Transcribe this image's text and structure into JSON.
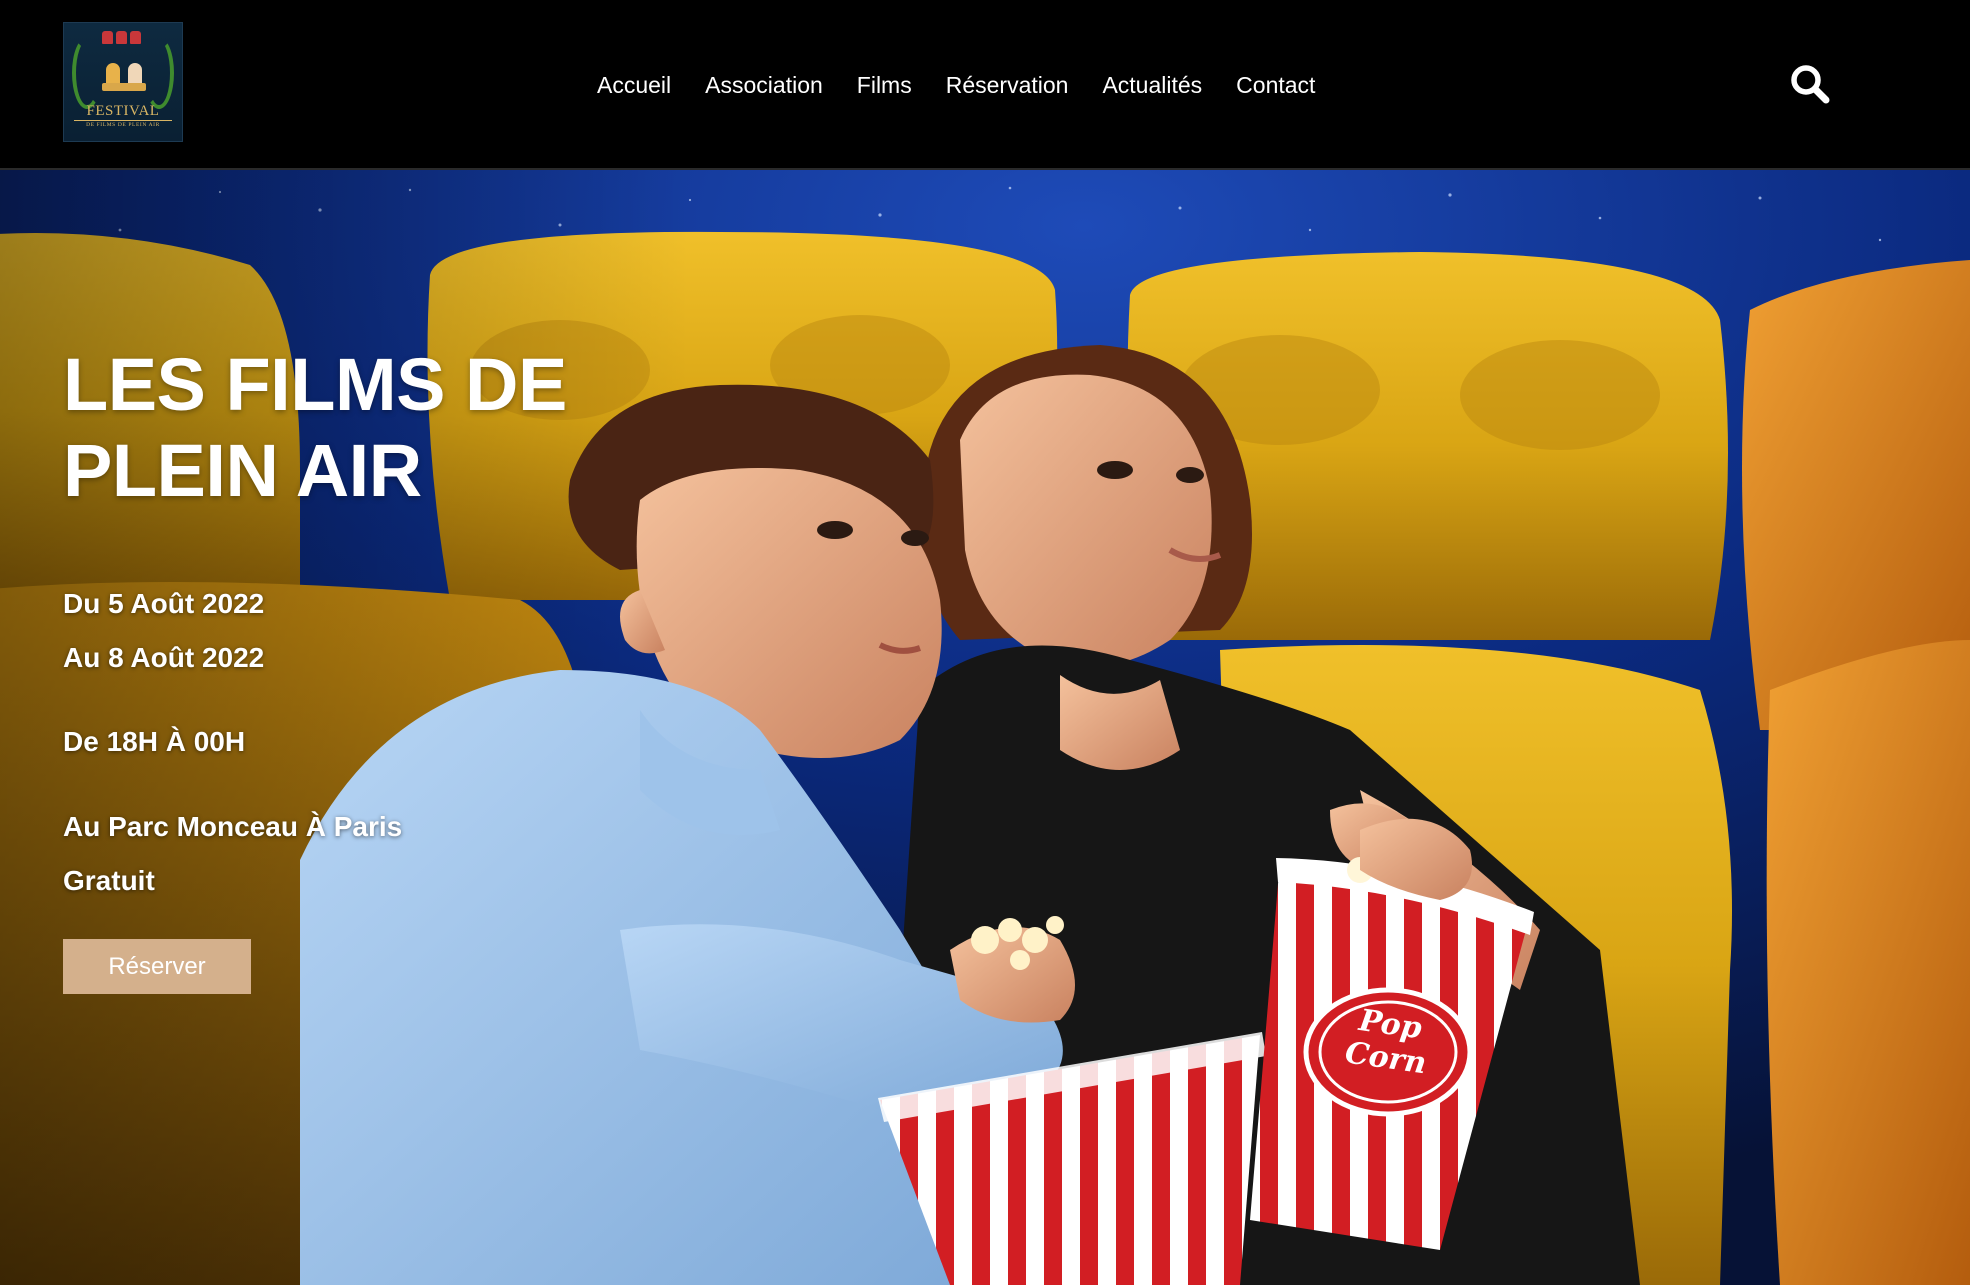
{
  "header": {
    "logo": {
      "title": "FESTIVAL",
      "subtitle": "DE FILMS DE PLEIN AIR"
    },
    "nav": [
      {
        "label": "Accueil"
      },
      {
        "label": "Association"
      },
      {
        "label": "Films"
      },
      {
        "label": "Réservation"
      },
      {
        "label": "Actualités"
      },
      {
        "label": "Contact"
      }
    ],
    "search_icon": "search-icon"
  },
  "hero": {
    "title_line1": "LES FILMS DE",
    "title_line2": "PLEIN AIR",
    "date_from": "Du 5 Août 2022",
    "date_to": "Au 8 Août 2022",
    "hours": "De 18H À 00H",
    "location": "Au Parc Monceau À Paris",
    "price": "Gratuit",
    "cta_label": "Réserver",
    "popcorn_text_1": "Pop",
    "popcorn_text_2": "Corn"
  },
  "colors": {
    "header_bg": "#000000",
    "cta_bg": "#d4b08c",
    "seat_yellow": "#d9a514",
    "sky_blue": "#0b2a80",
    "logo_gold": "#d8b564"
  }
}
